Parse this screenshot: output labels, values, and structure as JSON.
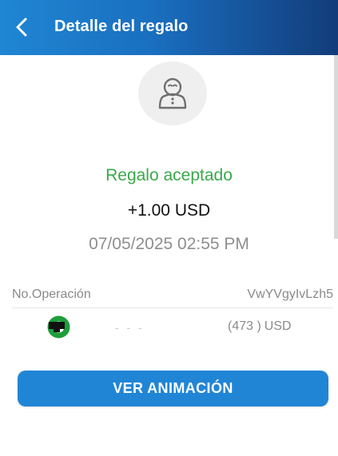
{
  "header": {
    "title": "Detalle del regalo",
    "back_icon": "chevron-left-icon"
  },
  "gift": {
    "status": "Regalo aceptado",
    "amount": "+1.00 USD",
    "datetime": "07/05/2025 02:55 PM",
    "operation_label": "No.Operación",
    "operation_value": "VwYVgyIvLzh5"
  },
  "sender": {
    "name": "- - -",
    "amount_value": "(473 )",
    "amount_currency": "USD",
    "icon": "sender-logo-icon"
  },
  "actions": {
    "view_animation_label": "VER ANIMACIÓN"
  },
  "colors": {
    "header_gradient_start": "#1f86d3",
    "header_gradient_end": "#123c7a",
    "status_green": "#3aa84a",
    "button_blue": "#2185d6"
  }
}
